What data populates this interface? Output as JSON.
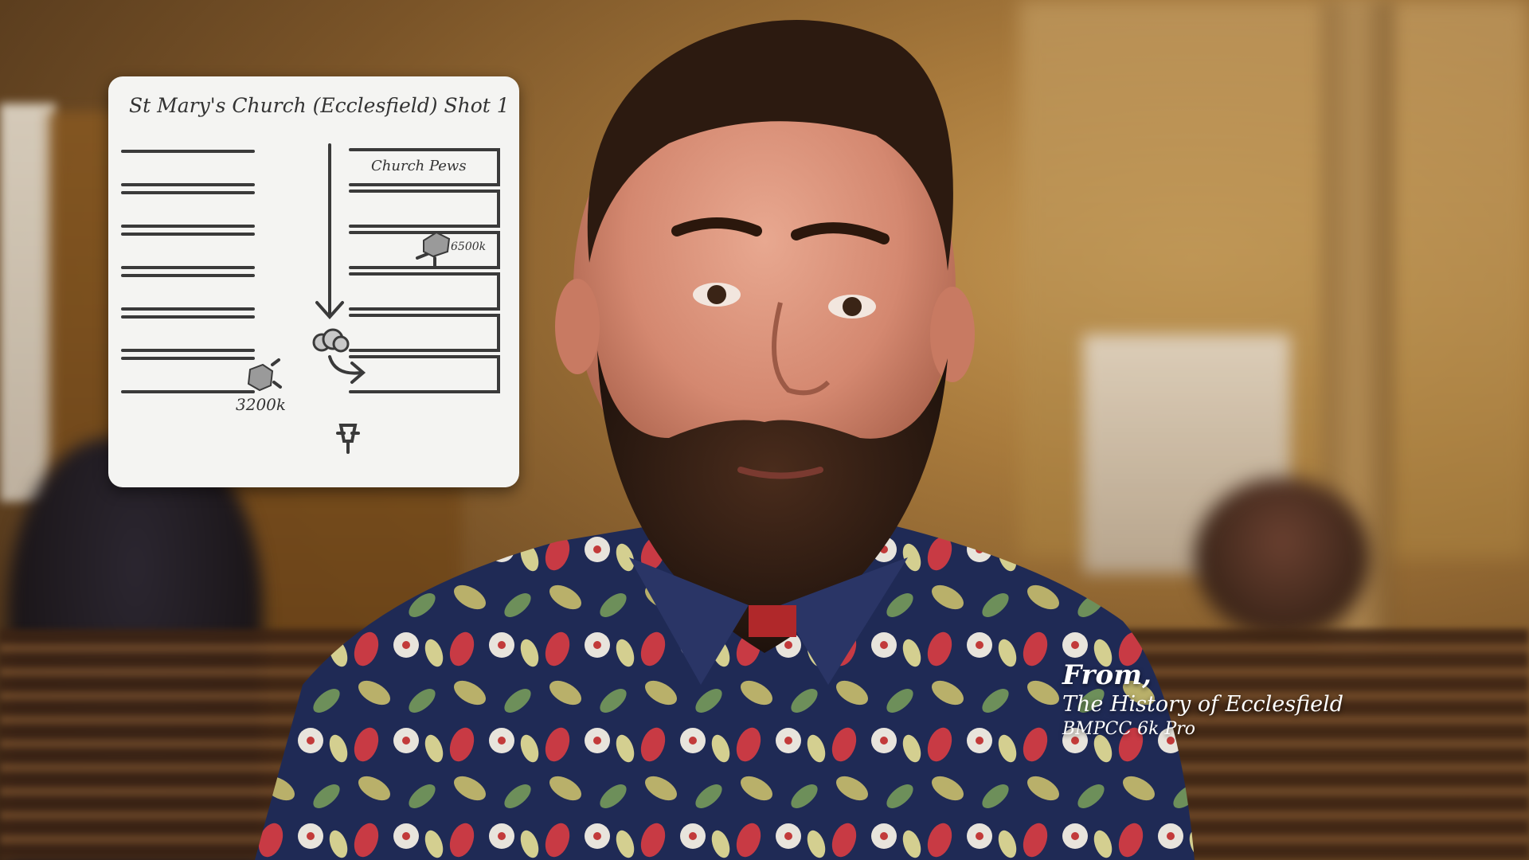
{
  "sketch": {
    "title": "St Mary's Church (Ecclesfield) Shot 1",
    "pews_label": "Church Pews",
    "light_right_label": "6500k",
    "light_left_label": "3200k"
  },
  "credit": {
    "from": "From,",
    "title": "The History of Ecclesfield",
    "camera": "BMPCC 6k Pro"
  },
  "colors": {
    "card_bg": "#f4f4f2",
    "ink": "#333333",
    "credit_text": "#ffffff"
  }
}
